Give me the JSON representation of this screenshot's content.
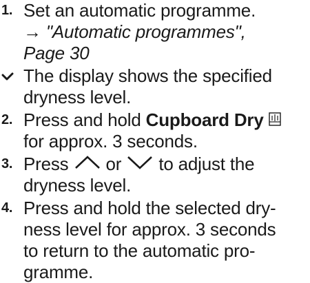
{
  "steps": [
    {
      "number": "1.",
      "text": "Set an automatic programme.",
      "ref_arrow": "→",
      "ref_text": "\"Automatic programmes\",",
      "ref_page": "Page 30"
    },
    {
      "result_text_a": "The display shows the specified",
      "result_text_b": "dryness level."
    },
    {
      "number": "2.",
      "text_a": "Press and hold ",
      "text_bold": "Cupboard Dry",
      "text_b": "for approx. 3 seconds."
    },
    {
      "number": "3.",
      "text_a": "Press",
      "text_or": "or",
      "text_b": "to adjust the",
      "text_c": "dryness level."
    },
    {
      "number": "4.",
      "line1": "Press and hold the selected dry-",
      "line2": "ness level for approx. 3 seconds",
      "line3": "to return to the automatic pro-",
      "line4": "gramme."
    }
  ],
  "icons": {
    "result": "check-icon",
    "cupboard_dry": "cupboard-dry-icon",
    "up": "chevron-up-icon",
    "down": "chevron-down-icon"
  }
}
